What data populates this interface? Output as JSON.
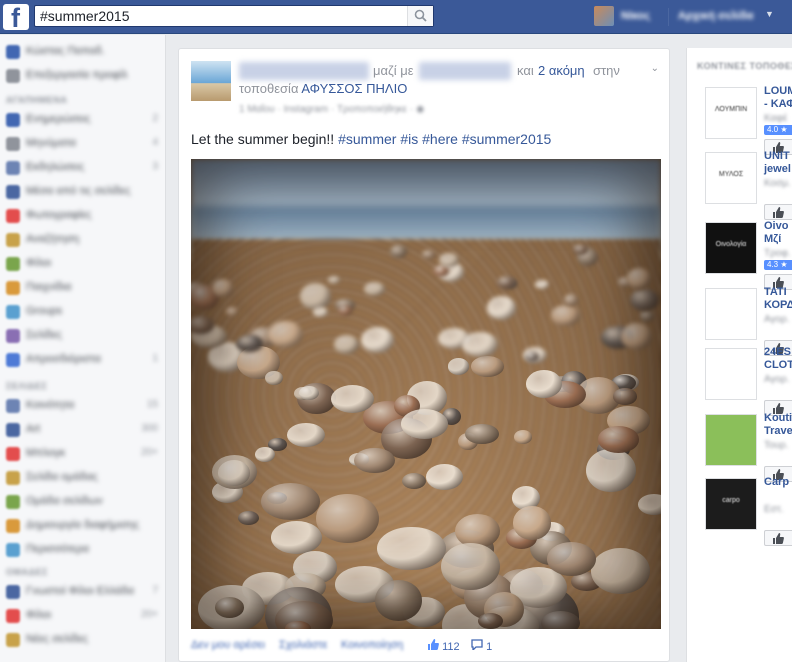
{
  "topbar": {
    "logo": "f",
    "search_value": "#summer2015",
    "user_name": "Νίκος",
    "home_label": "Αρχική σελίδα",
    "colors": {
      "bar": "#3b5998"
    }
  },
  "leftnav": {
    "items_top": [
      {
        "label": "Κώστας Παπαδ.",
        "count": ""
      },
      {
        "label": "Επεξεργασία προφίλ",
        "count": ""
      }
    ],
    "heading_favorites": "ΑΓΑΠΗΜΕΝΑ",
    "items_fav": [
      {
        "label": "Ενημερώσεις",
        "count": "2"
      },
      {
        "label": "Μηνύματα",
        "count": "4"
      },
      {
        "label": "Εκδηλώσεις",
        "count": "3"
      },
      {
        "label": "Μέσα από τις σελίδες",
        "count": ""
      },
      {
        "label": "Φωτογραφίες",
        "count": ""
      },
      {
        "label": "Αναζήτηση",
        "count": ""
      },
      {
        "label": "Φίλοι",
        "count": ""
      },
      {
        "label": "Παιχνίδια",
        "count": ""
      },
      {
        "label": "Groups",
        "count": ""
      },
      {
        "label": "Σελίδες",
        "count": ""
      },
      {
        "label": "Απροσδιόριστα",
        "count": "1"
      }
    ],
    "heading_pages": "ΣΕΛΙΔΕΣ",
    "items_pages": [
      {
        "label": "Κοινότητα",
        "count": "15"
      },
      {
        "label": "Art",
        "count": "300"
      },
      {
        "label": "Μπλογκ",
        "count": "20+"
      },
      {
        "label": "Σελίδα ομάδας",
        "count": ""
      },
      {
        "label": "Ομάδα σελίδων",
        "count": ""
      },
      {
        "label": "Δημιουργία διαφήμισης",
        "count": ""
      },
      {
        "label": "Περισσότερα",
        "count": ""
      }
    ],
    "heading_groups": "ΟΜΑΔΕΣ",
    "items_groups": [
      {
        "label": "Γνωστοί Φίλοι Ελλάδα",
        "count": "7"
      },
      {
        "label": "Φίλοι",
        "count": "20+"
      },
      {
        "label": "Νέες σελίδες",
        "count": ""
      }
    ]
  },
  "post": {
    "with_text": "μαζί με",
    "and_text": "και",
    "others_link": "2 ακόμη",
    "at_text": "στην",
    "location_prefix": "τοποθεσία",
    "location": "ΑΦΥΣΣΟΣ ΠΗΛΙΟ",
    "meta": "1 Μαΐου · Instagram · Τροποποιήθηκε · ",
    "body_text": "Let the summer begin!! ",
    "hashtags": [
      "#summer",
      "#is",
      "#here",
      "#summer2015"
    ],
    "actions": {
      "like": "Δεν μου αρέσει",
      "comment": "Σχολιάστε",
      "share": "Κοινοποίηση",
      "likes_count": "112",
      "comments_count": "1"
    }
  },
  "rightcol": {
    "heading": "ΚΟΝΤΙΝΕΣ ΤΟΠΟΘΕΣΙΕΣ",
    "items": [
      {
        "title": "LOUM\n- ΚΑΦ",
        "sub": "Καφέ",
        "rating": "4.0 ★",
        "thumb_color": "#ffffff",
        "thumb_text": "ΛΟΥΜΠΙΝ"
      },
      {
        "title": "UNIT\njewel",
        "sub": "Κοσμ.",
        "rating": "",
        "thumb_color": "#ffffff",
        "thumb_text": "ΜΥΛΟΣ"
      },
      {
        "title": "Oivo\nΜζί",
        "sub": "Τροφ.",
        "rating": "4.3 ★",
        "thumb_color": "#111111",
        "thumb_text": "Οινολογία"
      },
      {
        "title": "ΤΑΤΙ\nΚΟΡΔ",
        "sub": "Αγορ.",
        "rating": "",
        "thumb_color": "#ffffff",
        "thumb_text": ""
      },
      {
        "title": "24ES\nCLOT",
        "sub": "Αγορ.",
        "rating": "",
        "thumb_color": "#ffffff",
        "thumb_text": ""
      },
      {
        "title": "Kouti\nTrave",
        "sub": "Τουρ.",
        "rating": "",
        "thumb_color": "#8bbf5a",
        "thumb_text": ""
      },
      {
        "title": "Carp",
        "sub": "Εστ.",
        "rating": "",
        "thumb_color": "#1c1c1c",
        "thumb_text": "carpo"
      }
    ]
  }
}
